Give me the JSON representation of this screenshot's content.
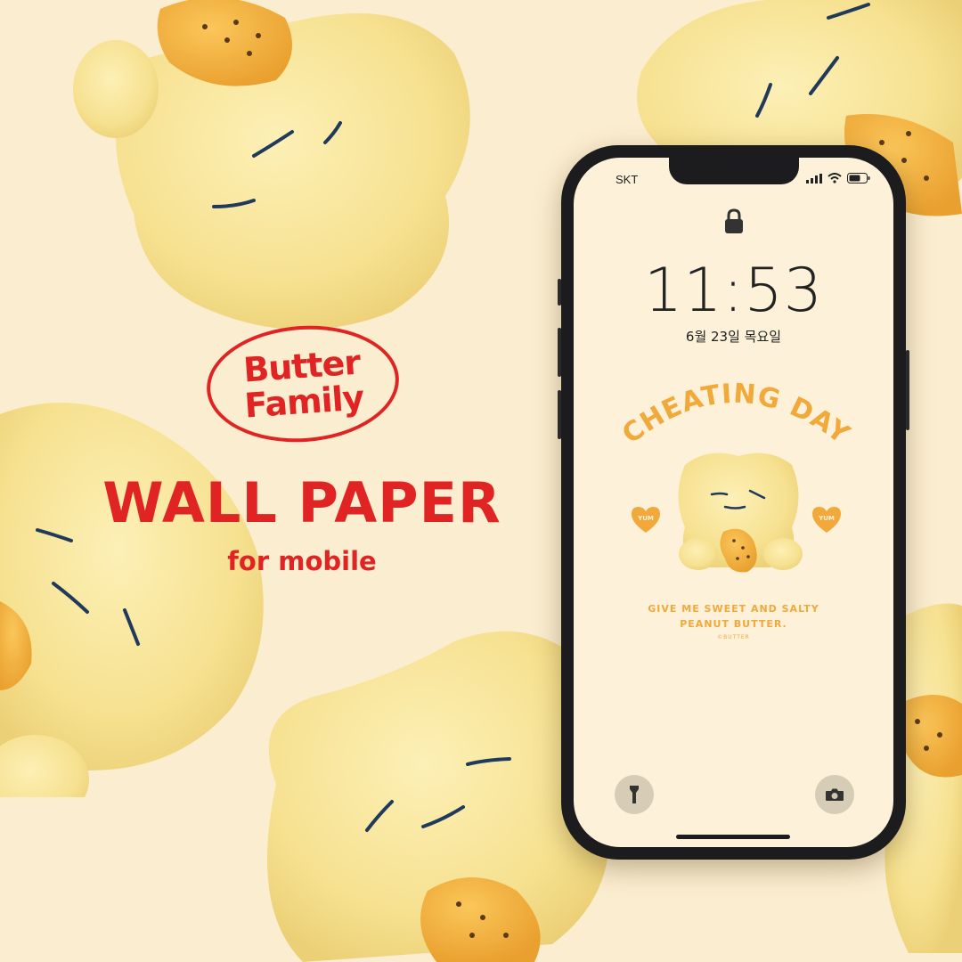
{
  "brand": {
    "line1": "Butter",
    "line2": "Family"
  },
  "headline": "WALL PAPER",
  "subhead": "for mobile",
  "phone": {
    "carrier": "SKT",
    "time": "11:53",
    "date": "6월 23일 목요일",
    "wallpaper": {
      "arc_title": "CHEATING DAY",
      "heart_left": "YUM",
      "heart_right": "YUM",
      "tagline_1": "GIVE ME SWEET AND SALTY",
      "tagline_2": "PEANUT BUTTER.",
      "copyright": "©BUTTER"
    }
  },
  "colors": {
    "background": "#fbedcf",
    "brand_red": "#e02424",
    "wallpaper_orange": "#f0a93a",
    "plush_yellow": "#f8e6a0"
  }
}
